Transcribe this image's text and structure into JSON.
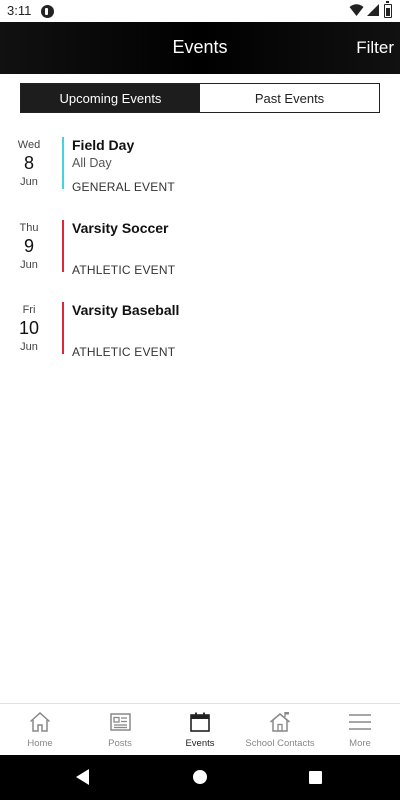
{
  "status_bar": {
    "time": "3:11"
  },
  "app_bar": {
    "title": "Events",
    "filter_label": "Filter"
  },
  "tabs": [
    {
      "label": "Upcoming Events",
      "active": true
    },
    {
      "label": "Past Events",
      "active": false
    }
  ],
  "events": [
    {
      "dow": "Wed",
      "day": "8",
      "month": "Jun",
      "title": "Field Day",
      "time": "All Day",
      "category": "GENERAL EVENT",
      "color": "#3fd6e0"
    },
    {
      "dow": "Thu",
      "day": "9",
      "month": "Jun",
      "title": "Varsity Soccer",
      "time": "",
      "category": "ATHLETIC EVENT",
      "color": "#e0263a"
    },
    {
      "dow": "Fri",
      "day": "10",
      "month": "Jun",
      "title": "Varsity Baseball",
      "time": "",
      "category": "ATHLETIC EVENT",
      "color": "#e0263a"
    }
  ],
  "bottom_nav": [
    {
      "label": "Home",
      "icon": "home-icon",
      "active": false
    },
    {
      "label": "Posts",
      "icon": "newspaper-icon",
      "active": false
    },
    {
      "label": "Events",
      "icon": "calendar-icon",
      "active": true
    },
    {
      "label": "School Contacts",
      "icon": "school-house-icon",
      "active": false
    },
    {
      "label": "More",
      "icon": "menu-icon",
      "active": false
    }
  ]
}
